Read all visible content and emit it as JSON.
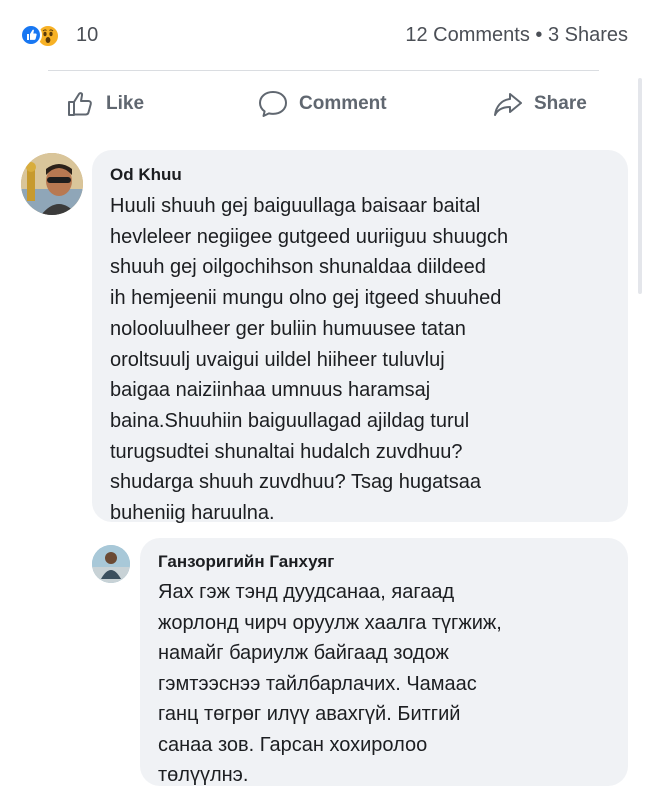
{
  "reactions": {
    "icons": [
      "like-icon",
      "wow-icon"
    ],
    "count": "10",
    "comments_shares": "12 Comments • 3 Shares"
  },
  "actions": {
    "like": "Like",
    "comment": "Comment",
    "share": "Share"
  },
  "comments": [
    {
      "author": "Od Khuu",
      "text": "Huuli shuuh gej baiguullaga baisaar baital\nhevleleer negiigee gutgeed uuriiguu shuugch\nshuuh gej oilgochihson shunaldaa diildeed\nih hemjeenii mungu olno gej itgeed shuuhed\nnolooluulheer ger buliin humuusee tatan\noroltsuulj uvaigui uildel hiiheer tuluvluj\nbaigaa naiziinhaa umnuus haramsaj\nbaina.Shuuhiin baiguullagad ajildag turul\nturugsudtei shunaltai hudalch zuvdhuu?\nshudarga shuuh zuvdhuu? Tsag hugatsaa\nbuheniig haruulna."
    },
    {
      "author": "Ганзоригийн Ганхуяг",
      "text": "Яах гэж тэнд дуудсанаа, яагаад\nжорлонд чирч оруулж хаалга түгжиж,\nнамайг бариулж байгаад зодож\nгэмтээснээ тайлбарлачих. Чамаас\nганц төгрөг илүү авахгүй. Битгий\nсанаа зов. Гарсан хохиролоо\nтөлүүлнэ."
    }
  ],
  "colors": {
    "like_blue": "#1877f2",
    "wow_yellow": "#f7b125",
    "bubble_bg": "#f0f2f5",
    "muted_text": "#606770"
  }
}
